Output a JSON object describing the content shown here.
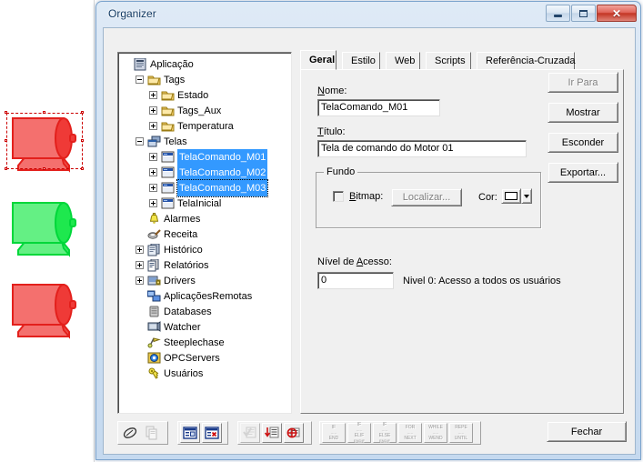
{
  "window": {
    "title": "Organizer",
    "controls": {
      "minimize": "minimize",
      "maximize": "maximize",
      "close": "✕"
    }
  },
  "tree": {
    "nodes": [
      {
        "label": "Aplicação",
        "depth": 0,
        "expander": "none",
        "icon": "application-icon",
        "selected": false
      },
      {
        "label": "Tags",
        "depth": 1,
        "expander": "minus",
        "icon": "folder-icon",
        "selected": false
      },
      {
        "label": "Estado",
        "depth": 2,
        "expander": "plus",
        "icon": "folder-icon",
        "selected": false
      },
      {
        "label": "Tags_Aux",
        "depth": 2,
        "expander": "plus",
        "icon": "folder-icon",
        "selected": false
      },
      {
        "label": "Temperatura",
        "depth": 2,
        "expander": "plus",
        "icon": "folder-icon",
        "selected": false
      },
      {
        "label": "Telas",
        "depth": 1,
        "expander": "minus",
        "icon": "screens-icon",
        "selected": false
      },
      {
        "label": "TelaComando_M01",
        "depth": 2,
        "expander": "plus",
        "icon": "screen-icon",
        "selected": true
      },
      {
        "label": "TelaComando_M02",
        "depth": 2,
        "expander": "plus",
        "icon": "screen-icon",
        "selected": true
      },
      {
        "label": "TelaComando_M03",
        "depth": 2,
        "expander": "plus",
        "icon": "screen-icon",
        "selected": true,
        "focused": true
      },
      {
        "label": "TelaInicial",
        "depth": 2,
        "expander": "plus",
        "icon": "screen-icon",
        "selected": false
      },
      {
        "label": "Alarmes",
        "depth": 1,
        "expander": "none",
        "icon": "bell-icon",
        "selected": false
      },
      {
        "label": "Receita",
        "depth": 1,
        "expander": "none",
        "icon": "recipe-icon",
        "selected": false
      },
      {
        "label": "Histórico",
        "depth": 1,
        "expander": "plus",
        "icon": "history-icon",
        "selected": false
      },
      {
        "label": "Relatórios",
        "depth": 1,
        "expander": "plus",
        "icon": "reports-icon",
        "selected": false
      },
      {
        "label": "Drivers",
        "depth": 1,
        "expander": "plus",
        "icon": "drivers-icon",
        "selected": false
      },
      {
        "label": "AplicaçõesRemotas",
        "depth": 1,
        "expander": "none",
        "icon": "remote-apps-icon",
        "selected": false
      },
      {
        "label": "Databases",
        "depth": 1,
        "expander": "none",
        "icon": "database-icon",
        "selected": false
      },
      {
        "label": "Watcher",
        "depth": 1,
        "expander": "none",
        "icon": "watcher-icon",
        "selected": false
      },
      {
        "label": "Steeplechase",
        "depth": 1,
        "expander": "none",
        "icon": "steeplechase-icon",
        "selected": false
      },
      {
        "label": "OPCServers",
        "depth": 1,
        "expander": "none",
        "icon": "opc-icon",
        "selected": false
      },
      {
        "label": "Usuários",
        "depth": 1,
        "expander": "none",
        "icon": "key-icon",
        "selected": false
      }
    ]
  },
  "tabs": [
    {
      "label": "Geral",
      "active": true
    },
    {
      "label": "Estilo",
      "active": false
    },
    {
      "label": "Web",
      "active": false
    },
    {
      "label": "Scripts",
      "active": false
    },
    {
      "label": "Referência-Cruzada",
      "active": false
    }
  ],
  "form": {
    "nome_label": "Nome:",
    "nome_value": "TelaComando_M01",
    "titulo_label": "Título:",
    "titulo_value": "Tela de comando do Motor 01",
    "fundo_group": "Fundo",
    "bitmap_label": "Bitmap:",
    "bitmap_checked": false,
    "localizar_label": "Localizar...",
    "localizar_enabled": false,
    "cor_label": "Cor:",
    "cor_value": "#ffffff",
    "nivel_label": "Nível de Acesso:",
    "nivel_value": "0",
    "nivel_hint": "Nivel 0: Acesso a todos os usuários"
  },
  "side_buttons": [
    {
      "label": "Ir Para",
      "enabled": false,
      "name": "ir-para-button"
    },
    {
      "label": "Mostrar",
      "enabled": true,
      "name": "mostrar-button"
    },
    {
      "label": "Esconder",
      "enabled": true,
      "name": "esconder-button"
    },
    {
      "label": "Exportar...",
      "enabled": true,
      "name": "exportar-button"
    }
  ],
  "toolbar": {
    "group1": [
      {
        "name": "edit-pencil-icon",
        "enabled": true
      },
      {
        "name": "copy-icon",
        "enabled": false
      }
    ],
    "group2": [
      {
        "name": "new-record-icon",
        "enabled": true
      },
      {
        "name": "delete-record-icon",
        "enabled": true
      }
    ],
    "group3": [
      {
        "name": "check-syntax-icon",
        "enabled": false
      },
      {
        "name": "insert-row-icon",
        "enabled": true
      },
      {
        "name": "remove-row-icon",
        "enabled": true
      }
    ],
    "code_blocks": [
      {
        "top": "IF",
        "bottom": "END",
        "mid": ""
      },
      {
        "top": "IF",
        "bottom": "ELIF",
        "mid": "ENDIF"
      },
      {
        "top": "IF",
        "bottom": "ELSE",
        "mid": "ENDIF"
      },
      {
        "top": "FOR",
        "bottom": "NEXT",
        "mid": ""
      },
      {
        "top": "WHILE",
        "bottom": "WEND",
        "mid": ""
      },
      {
        "top": "REPE",
        "bottom": "UNTIL",
        "mid": ""
      }
    ]
  },
  "footer": {
    "fechar_label": "Fechar"
  },
  "canvas": {
    "objects": [
      {
        "name": "motor-shape-red-selected",
        "color": "#f4706e",
        "dark": "#e3201c",
        "selected": true
      },
      {
        "name": "motor-shape-green",
        "color": "#64f084",
        "dark": "#00d73a",
        "selected": false
      },
      {
        "name": "motor-shape-red",
        "color": "#f4706e",
        "dark": "#e3201c",
        "selected": false
      }
    ]
  }
}
